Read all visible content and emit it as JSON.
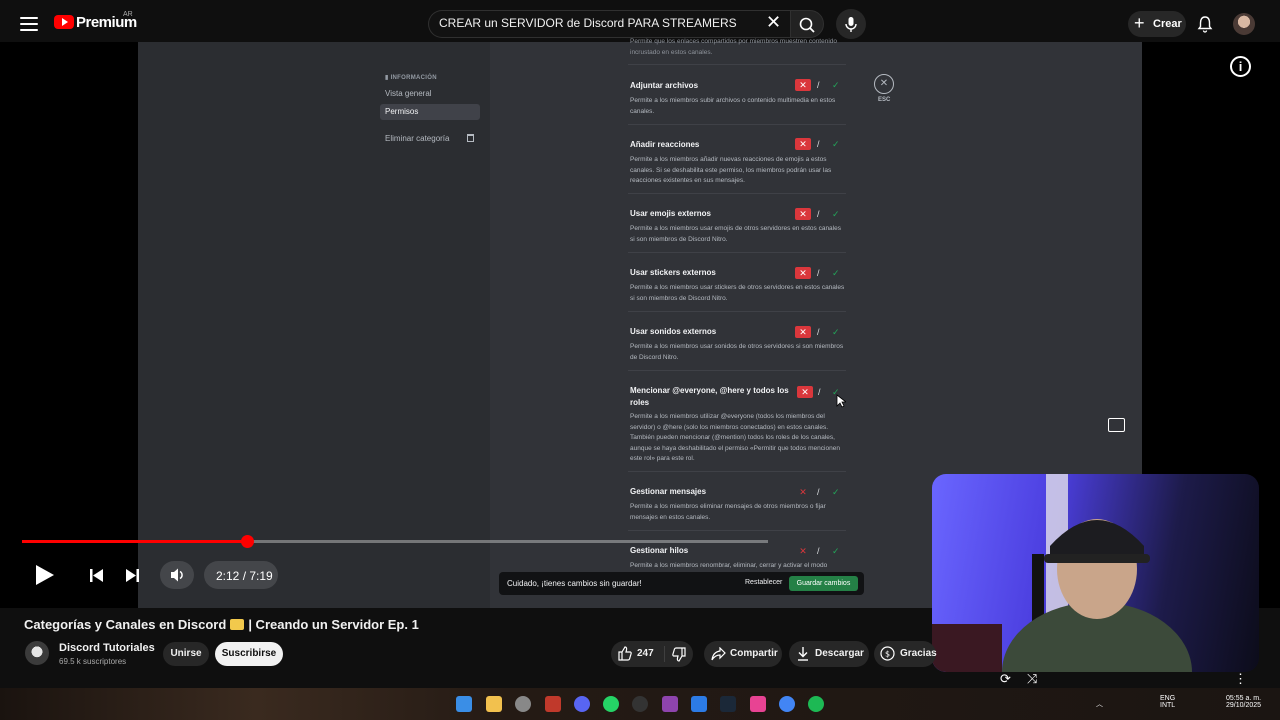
{
  "header": {
    "brand": "Premium",
    "country": "AR",
    "search_value": "CREAR un SERVIDOR de Discord PARA STREAMERS",
    "create_label": "Crear"
  },
  "discord": {
    "sidebar": {
      "section": "INFORMACIÓN",
      "items": [
        {
          "label": "Vista general"
        },
        {
          "label": "Permisos"
        },
        {
          "label": "Eliminar categoría"
        }
      ]
    },
    "top_fragment": "Permite que los enlaces compartidos por miembros muestren contenido incrustado en estos canales.",
    "permissions": [
      {
        "title": "Adjuntar archivos",
        "desc": "Permite a los miembros subir archivos o contenido multimedia en estos canales."
      },
      {
        "title": "Añadir reacciones",
        "desc": "Permite a los miembros añadir nuevas reacciones de emojis a estos canales. Si se deshabilita este permiso, los miembros podrán usar las reacciones existentes en sus mensajes."
      },
      {
        "title": "Usar emojis externos",
        "desc": "Permite a los miembros usar emojis de otros servidores en estos canales si son miembros de Discord Nitro."
      },
      {
        "title": "Usar stickers externos",
        "desc": "Permite a los miembros usar stickers de otros servidores en estos canales si son miembros de Discord Nitro."
      },
      {
        "title": "Usar sonidos externos",
        "desc": "Permite a los miembros usar sonidos de otros servidores si son miembros de Discord Nitro."
      },
      {
        "title": "Mencionar @everyone, @here y todos los roles",
        "desc": "Permite a los miembros utilizar @everyone (todos los miembros del servidor) o @here (solo los miembros conectados) en estos canales. También pueden mencionar (@mention) todos los roles de los canales, aunque se haya deshabilitado el permiso «Permitir que todos mencionen este rol» para este rol."
      },
      {
        "title": "Gestionar mensajes",
        "desc": "Permite a los miembros eliminar mensajes de otros miembros o fijar mensajes en estos canales."
      },
      {
        "title": "Gestionar hilos",
        "desc": "Permite a los miembros renombrar, eliminar, cerrar y activar el modo"
      }
    ],
    "esc_label": "ESC",
    "unsaved_text": "Cuidado, ¡tienes cambios sin guardar!",
    "reset_label": "Restablecer",
    "save_label": "Guardar cambios"
  },
  "player": {
    "time": "2:12 / 7:19",
    "progress_fraction": 0.301
  },
  "video": {
    "title_part1": "Categorías y Canales en Discord",
    "title_part2": "| Creando un Servidor Ep. 1",
    "channel_name": "Discord Tutoriales",
    "subscribers": "69.5 k suscriptores",
    "join_label": "Unirse",
    "subscribe_label": "Suscribirse",
    "likes": "247",
    "share_label": "Compartir",
    "download_label": "Descargar",
    "thanks_label": "Gracias"
  },
  "taskbar": {
    "lang1": "ENG",
    "lang2": "INTL",
    "time": "05:55 a. m.",
    "date": "29/10/2025"
  },
  "colors": {
    "accent": "#ff0000",
    "discord_bg": "#313338",
    "deny_red": "#da373c",
    "allow_green": "#23a559",
    "save_green": "#248046"
  }
}
